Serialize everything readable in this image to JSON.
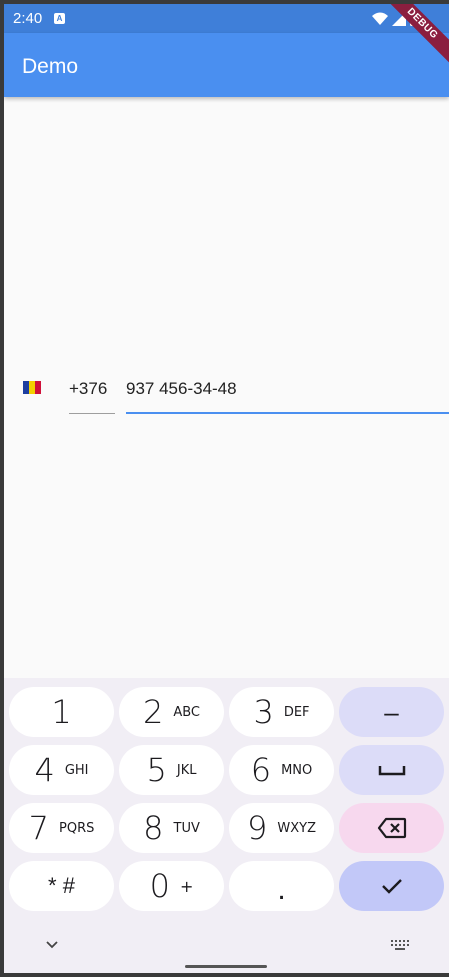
{
  "status_bar": {
    "time": "2:40",
    "a_icon": "A"
  },
  "debug_banner": "DEBUG",
  "app_bar": {
    "title": "Demo"
  },
  "phone_input": {
    "country": "Andorra flag",
    "flag_colors": [
      "#1d3fa0",
      "#f3d000",
      "#d0103a"
    ],
    "dial_code": "+376",
    "number": "937 456-34-48"
  },
  "keypad": {
    "rows": [
      [
        {
          "d": "1",
          "l": ""
        },
        {
          "d": "2",
          "l": "ABC"
        },
        {
          "d": "3",
          "l": "DEF"
        }
      ],
      [
        {
          "d": "4",
          "l": "GHI"
        },
        {
          "d": "5",
          "l": "JKL"
        },
        {
          "d": "6",
          "l": "MNO"
        }
      ],
      [
        {
          "d": "7",
          "l": "PQRS"
        },
        {
          "d": "8",
          "l": "TUV"
        },
        {
          "d": "9",
          "l": "WXYZ"
        }
      ],
      [
        {
          "d": "* #",
          "l": ""
        },
        {
          "d": "0",
          "l": "+"
        },
        {
          "d": ".",
          "l": ""
        }
      ]
    ],
    "function_keys": [
      "–",
      "␣",
      "backspace",
      "✓"
    ]
  },
  "colors": {
    "accent": "#4a8ff0",
    "status_bar": "#3f7fd9"
  }
}
